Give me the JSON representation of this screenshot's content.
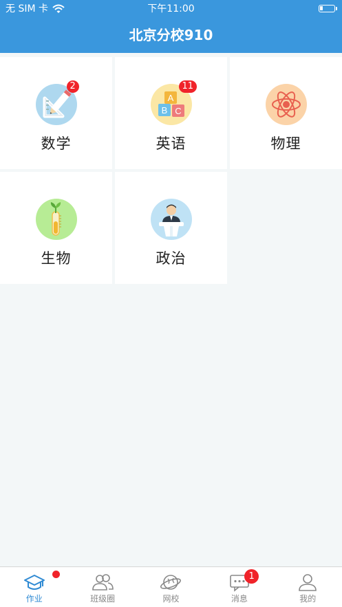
{
  "status_bar": {
    "carrier": "无 SIM 卡",
    "time": "下午11:00"
  },
  "header": {
    "title": "北京分校910"
  },
  "subjects": [
    {
      "label": "数学",
      "icon": "math-icon",
      "badge": "2"
    },
    {
      "label": "英语",
      "icon": "english-abc-icon",
      "badge": "11"
    },
    {
      "label": "物理",
      "icon": "physics-atom-icon",
      "badge": ""
    },
    {
      "label": "生物",
      "icon": "biology-plant-icon",
      "badge": ""
    },
    {
      "label": "政治",
      "icon": "politics-speaker-icon",
      "badge": ""
    }
  ],
  "tabbar": {
    "tabs": [
      {
        "label": "作业",
        "icon": "homework-hat-icon",
        "active": true
      },
      {
        "label": "班级圈",
        "icon": "class-circle-icon",
        "active": false
      },
      {
        "label": "网校",
        "icon": "web-school-globe-icon",
        "active": false
      },
      {
        "label": "消息",
        "icon": "message-icon",
        "active": false,
        "badge": "1"
      },
      {
        "label": "我的",
        "icon": "profile-icon",
        "active": false
      }
    ]
  },
  "colors": {
    "header": "#3a97dd",
    "accent": "#2f8ad3",
    "badge": "#f0232a",
    "background": "#f3f7f8"
  }
}
